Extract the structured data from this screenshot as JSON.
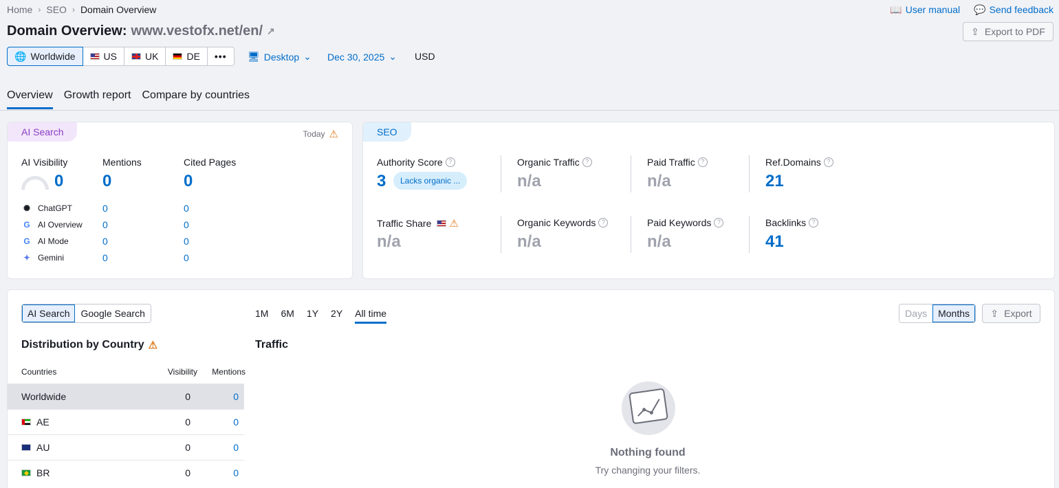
{
  "breadcrumb": {
    "home": "Home",
    "seo": "SEO",
    "current": "Domain Overview"
  },
  "toplinks": {
    "manual": "User manual",
    "feedback": "Send feedback"
  },
  "header": {
    "title": "Domain Overview:",
    "domain": "www.vestofx.net/en/",
    "export_pdf": "Export to PDF"
  },
  "regions": [
    "Worldwide",
    "US",
    "UK",
    "DE"
  ],
  "filters": {
    "device": "Desktop",
    "date": "Dec 30, 2025",
    "currency": "USD"
  },
  "tabs": [
    "Overview",
    "Growth report",
    "Compare by countries"
  ],
  "ai_card": {
    "badge": "AI Search",
    "today": "Today",
    "metrics": [
      {
        "label": "AI Visibility",
        "value": "0"
      },
      {
        "label": "Mentions",
        "value": "0"
      },
      {
        "label": "Cited Pages",
        "value": "0"
      }
    ],
    "rows": [
      {
        "name": "ChatGPT",
        "mentions": "0",
        "cited": "0"
      },
      {
        "name": "AI Overview",
        "mentions": "0",
        "cited": "0"
      },
      {
        "name": "AI Mode",
        "mentions": "0",
        "cited": "0"
      },
      {
        "name": "Gemini",
        "mentions": "0",
        "cited": "0"
      }
    ]
  },
  "seo_card": {
    "badge": "SEO",
    "authority": {
      "label": "Authority Score",
      "value": "3",
      "tag": "Lacks organic ..."
    },
    "organic_traffic": {
      "label": "Organic Traffic",
      "value": "n/a"
    },
    "paid_traffic": {
      "label": "Paid Traffic",
      "value": "n/a"
    },
    "ref_domains": {
      "label": "Ref.Domains",
      "value": "21"
    },
    "traffic_share": {
      "label": "Traffic Share",
      "value": "n/a"
    },
    "organic_keywords": {
      "label": "Organic Keywords",
      "value": "n/a"
    },
    "paid_keywords": {
      "label": "Paid Keywords",
      "value": "n/a"
    },
    "backlinks": {
      "label": "Backlinks",
      "value": "41"
    }
  },
  "bottom": {
    "source_tabs": [
      "AI Search",
      "Google Search"
    ],
    "periods": [
      "1M",
      "6M",
      "1Y",
      "2Y",
      "All time"
    ],
    "granularity": [
      "Days",
      "Months"
    ],
    "export": "Export",
    "dist_title": "Distribution by Country",
    "traffic_title": "Traffic",
    "table_headers": {
      "countries": "Countries",
      "visibility": "Visibility",
      "mentions": "Mentions"
    },
    "table_rows": [
      {
        "country": "Worldwide",
        "visibility": "0",
        "mentions": "0"
      },
      {
        "country": "AE",
        "visibility": "0",
        "mentions": "0"
      },
      {
        "country": "AU",
        "visibility": "0",
        "mentions": "0"
      },
      {
        "country": "BR",
        "visibility": "0",
        "mentions": "0"
      }
    ],
    "empty_title": "Nothing found",
    "empty_sub": "Try changing your filters."
  }
}
